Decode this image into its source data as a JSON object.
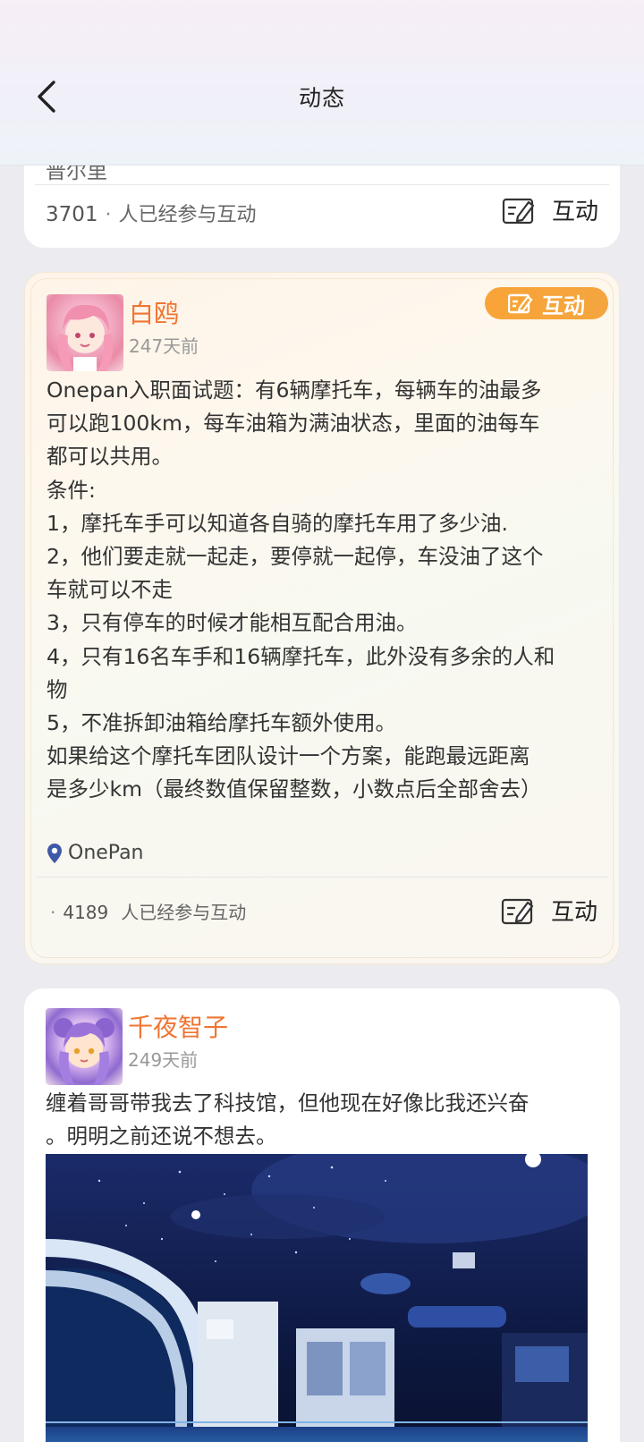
{
  "header": {
    "title": "动态"
  },
  "posts": [
    {
      "location_partial": "普尔里",
      "count": "3701",
      "count_suffix": "人已经参与互动",
      "interact_label": "互动"
    },
    {
      "username": "白鸥",
      "time": "247天前",
      "badge_label": "互动",
      "body": "Onepan入职面试题：有6辆摩托车，每辆车的油最多\n可以跑100km，每车油箱为满油状态，里面的油每车\n都可以共用。\n条件:\n1，摩托车手可以知道各自骑的摩托车用了多少油.\n2，他们要走就一起走，要停就一起停，车没油了这个\n车就可以不走\n3，只有停车的时候才能相互配合用油。\n4，只有16名车手和16辆摩托车，此外没有多余的人和\n物\n5，不准拆卸油箱给摩托车额外使用。\n如果给这个摩托车团队设计一个方案，能跑最远距离\n是多少km（最终数值保留整数，小数点后全部舍去）",
      "location": "OnePan",
      "count": "4189",
      "count_suffix": "人已经参与互动",
      "interact_label": "互动"
    },
    {
      "username": "千夜智子",
      "time": "249天前",
      "body": "缠着哥哥带我去了科技馆，但他现在好像比我还兴奋\n。明明之前还说不想去。"
    }
  ],
  "colors": {
    "username": "#ef7532",
    "badge": "#f6a53b",
    "location_pin": "#3f58a8"
  }
}
